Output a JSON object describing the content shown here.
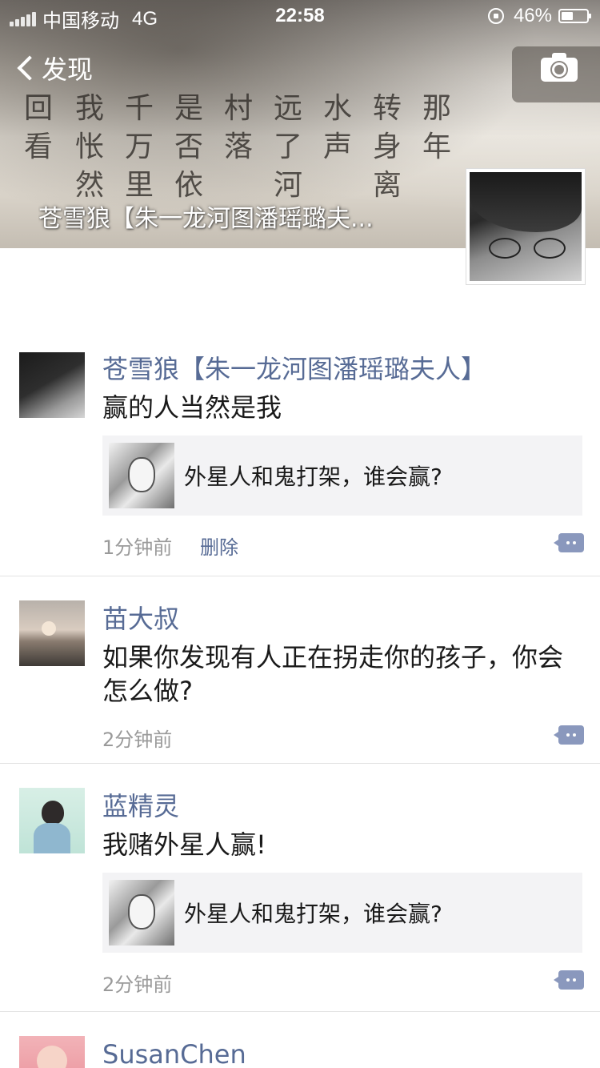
{
  "status_bar": {
    "carrier": "中国移动",
    "network": "4G",
    "time": "22:58",
    "battery": "46%",
    "battery_level": 0.46
  },
  "nav": {
    "back_label": "发现",
    "back_icon": "chevron-left-icon",
    "camera_icon": "camera-icon"
  },
  "cover": {
    "poem_columns": [
      "回看",
      "我怅然",
      "千万里",
      "是否依",
      "村落",
      "远了河",
      "水声",
      "转身离",
      "那年"
    ],
    "user_name": "苍雪狼【朱一龙河图潘瑶璐夫..."
  },
  "feed": [
    {
      "name": "苍雪狼【朱一龙河图潘瑶璐夫人】",
      "text": "赢的人当然是我",
      "quote": "外星人和鬼打架，谁会赢?",
      "time": "1分钟前",
      "delete_label": "删除"
    },
    {
      "name": "苗大叔",
      "text": "如果你发现有人正在拐走你的孩子，你会怎么做?",
      "time": "2分钟前"
    },
    {
      "name": "蓝精灵",
      "text": "我赌外星人赢!",
      "quote": "外星人和鬼打架，谁会赢?",
      "time": "2分钟前"
    },
    {
      "name": "SusanChen"
    }
  ],
  "colors": {
    "link": "#576b95",
    "time": "#9a9a9a",
    "comment_button": "#8a98bd"
  }
}
